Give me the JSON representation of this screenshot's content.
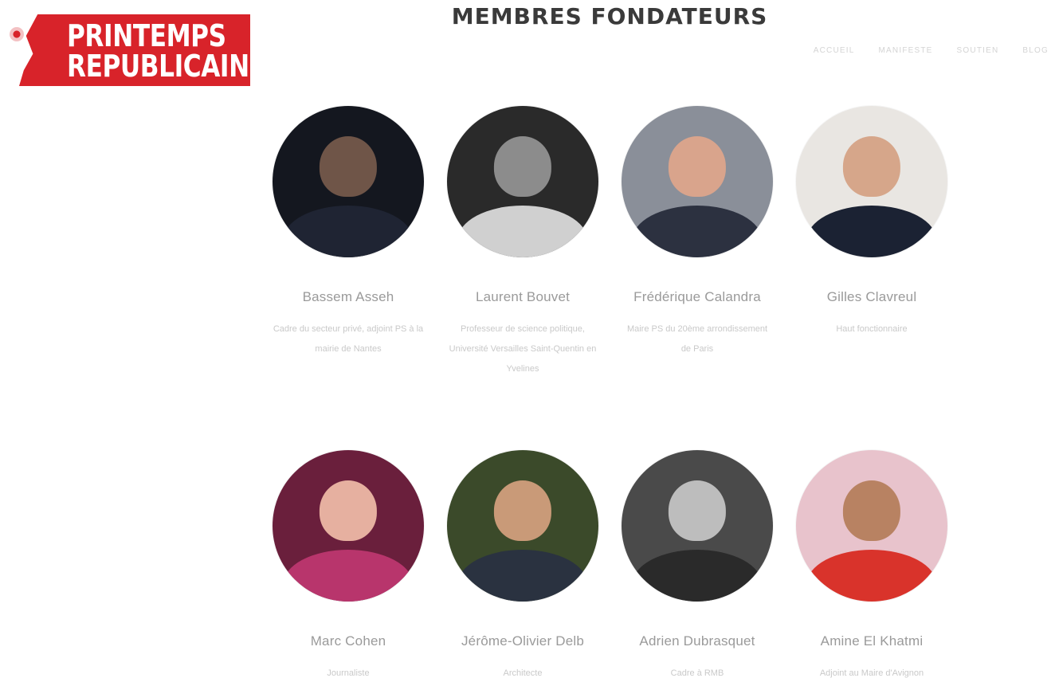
{
  "logo": {
    "line1": "PRINTEMPS",
    "line2": "REPUBLICAIN"
  },
  "nav": {
    "items": [
      "ACCUEIL",
      "MANIFESTE",
      "SOUTIEN",
      "BLOG"
    ]
  },
  "section": {
    "title": "MEMBRES FONDATEURS"
  },
  "members": [
    {
      "name": "Bassem Asseh",
      "role": "Cadre du secteur privé, adjoint PS à la mairie de Nantes",
      "avatar_colors": {
        "bg": "#14171f",
        "head": "#6f5548",
        "body": "#1f2433"
      }
    },
    {
      "name": "Laurent Bouvet",
      "role": "Professeur de science politique, Université Versailles Saint-Quentin en Yvelines",
      "avatar_colors": {
        "bg": "#2a2a2a",
        "head": "#8c8c8c",
        "body": "#d0d0d0"
      }
    },
    {
      "name": "Frédérique Calandra",
      "role": "Maire PS du 20ème arrondissement de Paris",
      "avatar_colors": {
        "bg": "#8a8f99",
        "head": "#d9a48c",
        "body": "#2c3140"
      }
    },
    {
      "name": "Gilles Clavreul",
      "role": "Haut fonctionnaire",
      "avatar_colors": {
        "bg": "#e9e6e2",
        "head": "#d6a68a",
        "body": "#1b2233"
      }
    },
    {
      "name": "Marc Cohen",
      "role": "Journaliste",
      "avatar_colors": {
        "bg": "#6a1f3c",
        "head": "#e6b0a0",
        "body": "#b8356c"
      }
    },
    {
      "name": "Jérôme-Olivier Delb",
      "role": "Architecte",
      "avatar_colors": {
        "bg": "#3b4a2a",
        "head": "#c99a78",
        "body": "#2a3240"
      }
    },
    {
      "name": "Adrien Dubrasquet",
      "role": "Cadre à RMB",
      "avatar_colors": {
        "bg": "#4a4a4a",
        "head": "#bdbdbd",
        "body": "#2a2a2a"
      }
    },
    {
      "name": "Amine El Khatmi",
      "role": "Adjoint au Maire d'Avignon",
      "avatar_colors": {
        "bg": "#e8c3cc",
        "head": "#b88262",
        "body": "#d9332b"
      }
    }
  ]
}
